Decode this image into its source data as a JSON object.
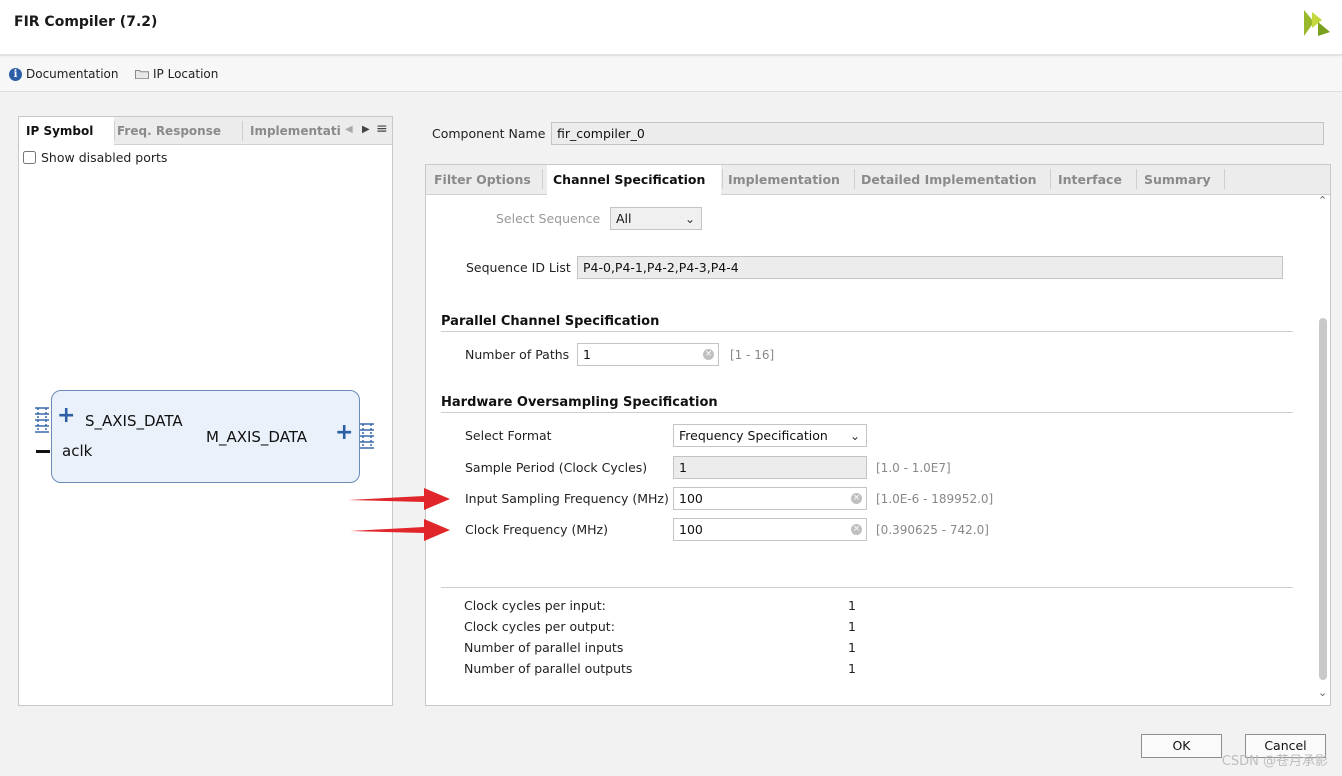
{
  "window": {
    "title": "FIR Compiler (7.2)"
  },
  "toolbar": {
    "documentation": "Documentation",
    "ip_location": "IP Location"
  },
  "left_panel": {
    "tabs": [
      "IP Symbol",
      "Freq. Response",
      "Implementati"
    ],
    "show_disabled_ports": "Show disabled ports",
    "ports": {
      "s_axis": "S_AXIS_DATA",
      "aclk": "aclk",
      "m_axis": "M_AXIS_DATA"
    }
  },
  "component": {
    "label": "Component Name",
    "value": "fir_compiler_0"
  },
  "right_tabs": [
    "Filter Options",
    "Channel Specification",
    "Implementation",
    "Detailed Implementation",
    "Interface",
    "Summary"
  ],
  "sequence": {
    "select_label": "Select Sequence",
    "select_value": "All",
    "id_list_label": "Sequence ID List",
    "id_list_value": "P4-0,P4-1,P4-2,P4-3,P4-4"
  },
  "parallel": {
    "title": "Parallel Channel Specification",
    "paths_label": "Number of Paths",
    "paths_value": "1",
    "paths_range": "[1 - 16]"
  },
  "oversampling": {
    "title": "Hardware Oversampling Specification",
    "format_label": "Select Format",
    "format_value": "Frequency Specification",
    "sample_period_label": "Sample Period (Clock Cycles)",
    "sample_period_value": "1",
    "sample_period_range": "[1.0 - 1.0E7]",
    "input_freq_label": "Input Sampling Frequency (MHz)",
    "input_freq_value": "100",
    "input_freq_range": "[1.0E-6 - 189952.0]",
    "clock_freq_label": "Clock Frequency (MHz)",
    "clock_freq_value": "100",
    "clock_freq_range": "[0.390625 - 742.0]"
  },
  "summary": [
    {
      "label": "Clock cycles per input:",
      "value": "1"
    },
    {
      "label": "Clock cycles per output:",
      "value": "1"
    },
    {
      "label": "Number of parallel inputs",
      "value": "1"
    },
    {
      "label": "Number of parallel outputs",
      "value": "1"
    }
  ],
  "buttons": {
    "ok": "OK",
    "cancel": "Cancel"
  },
  "watermark": "CSDN @苍月承影",
  "colors": {
    "accent": "#2c5fa5",
    "arrow": "#e0262a",
    "block_fill": "#eaf1fb",
    "block_border": "#6a8bb5"
  }
}
